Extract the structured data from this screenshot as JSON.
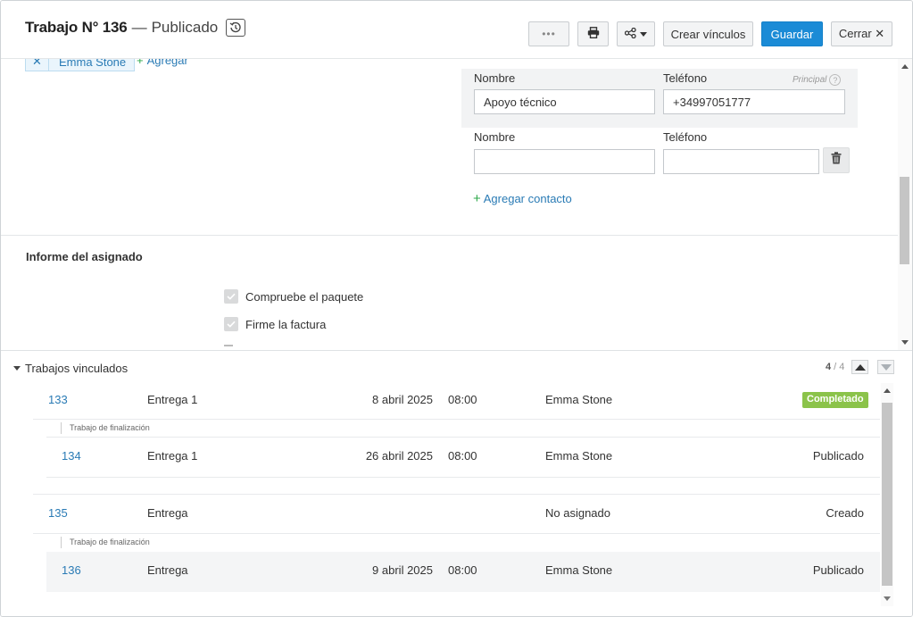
{
  "header": {
    "title": "Trabajo N° 136",
    "separator": "—",
    "status": "Publicado",
    "buttons": {
      "more": "•••",
      "create_links": "Crear vínculos",
      "save": "Guardar",
      "close": "Cerrar ✕"
    },
    "icons": [
      "history-icon",
      "print-icon",
      "share-icon",
      "chevron-down-icon"
    ]
  },
  "assignees": {
    "chip_remove": "✕",
    "name": "Emma Stone",
    "add_label": "Agregar"
  },
  "contacts": {
    "principal_label": "Principal",
    "principal_help": "?",
    "primary": {
      "name_label": "Nombre",
      "phone_label": "Teléfono",
      "name_value": "Apoyo técnico",
      "phone_value": "+34997051777"
    },
    "secondary": {
      "name_label": "Nombre",
      "phone_label": "Teléfono",
      "name_value": "",
      "phone_value": ""
    },
    "add_contact": "Agregar contacto"
  },
  "report": {
    "title": "Informe del asignado",
    "checks": [
      {
        "label": "Compruebe el paquete",
        "checked": true
      },
      {
        "label": "Firme la factura",
        "checked": true
      }
    ]
  },
  "linked_jobs": {
    "title": "Trabajos vinculados",
    "counter_current": "4",
    "counter_sep": " / ",
    "counter_total": "4",
    "sub_label": "Trabajo de finalización",
    "rows": [
      {
        "number": "133",
        "type": "Entrega 1",
        "date": "8 abril 2025",
        "time": "08:00",
        "assignee": "Emma Stone",
        "status": "Completado",
        "status_style": "badge"
      },
      {
        "number": "134",
        "type": "Entrega 1",
        "date": "26 abril 2025",
        "time": "08:00",
        "assignee": "Emma Stone",
        "status": "Publicado",
        "status_style": "text"
      },
      {
        "number": "135",
        "type": "Entrega",
        "date": "",
        "time": "",
        "assignee": "No asignado",
        "status": "Creado",
        "status_style": "text"
      },
      {
        "number": "136",
        "type": "Entrega",
        "date": "9 abril 2025",
        "time": "08:00",
        "assignee": "Emma Stone",
        "status": "Publicado",
        "status_style": "text"
      }
    ]
  },
  "colors": {
    "primary_button": "#1b8bd6",
    "link": "#2a7bb5",
    "add_plus": "#2ea84a",
    "completed_badge": "#8bc34a"
  }
}
